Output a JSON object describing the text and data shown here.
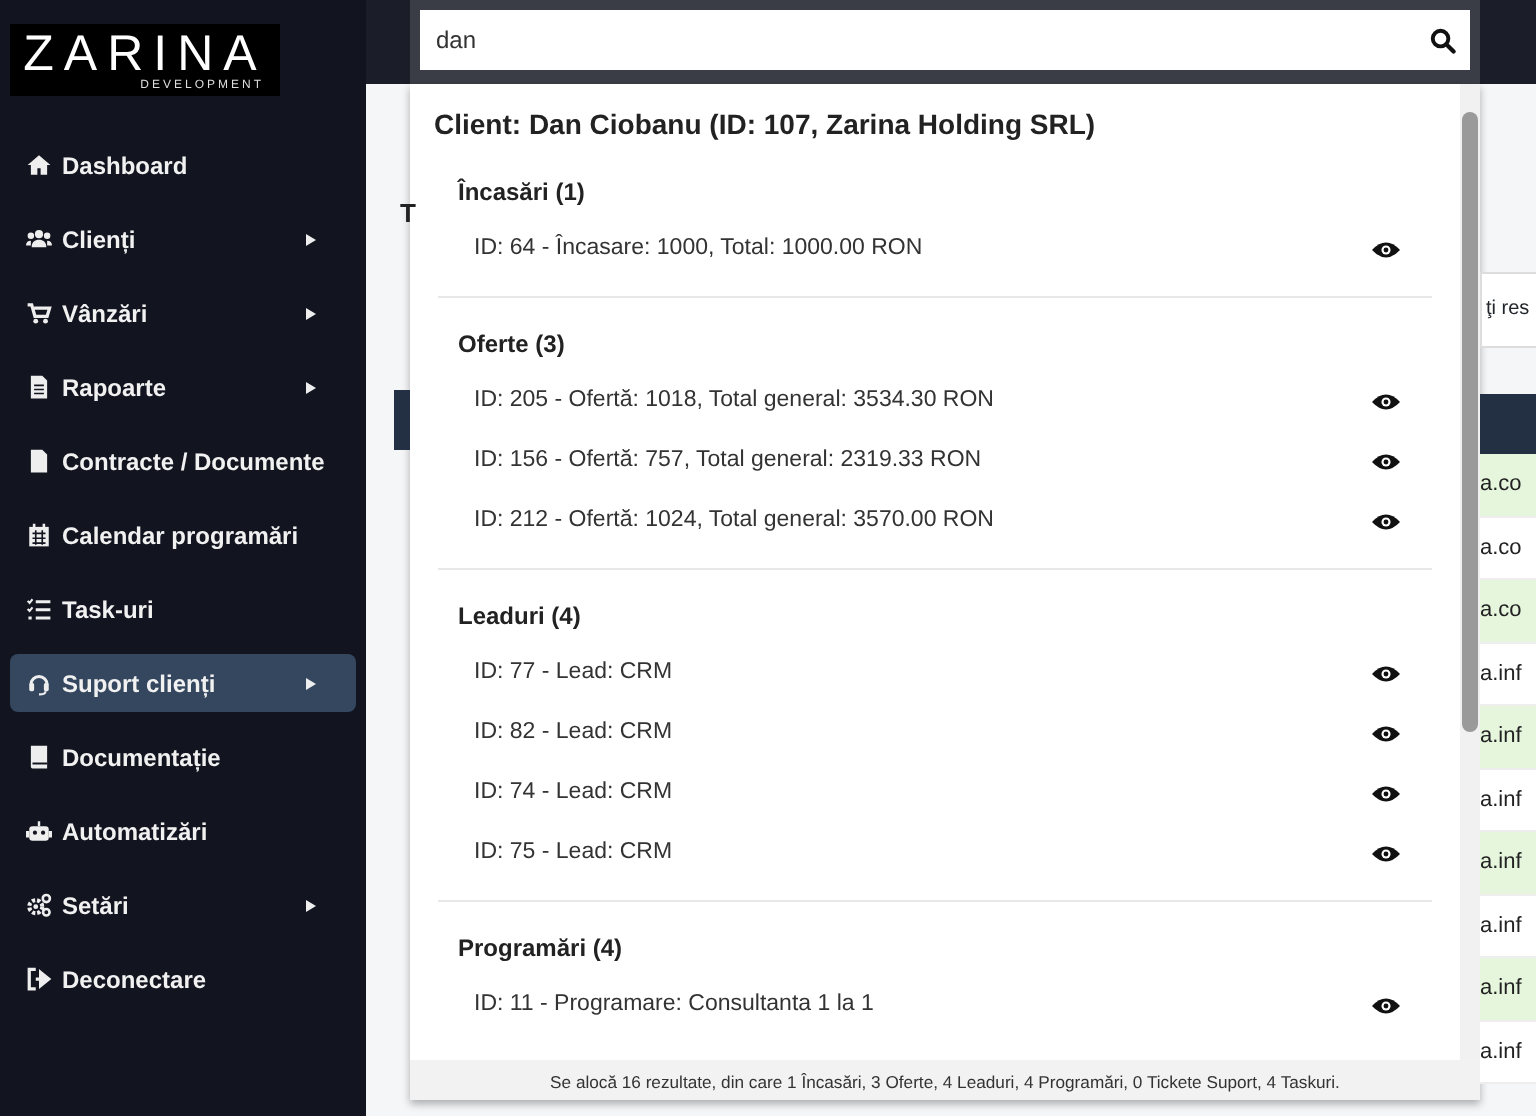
{
  "sidebar": {
    "logo": {
      "title": "ZARINA",
      "subtitle": "DEVELOPMENT"
    },
    "items": [
      {
        "label": "Dashboard",
        "has_submenu": false,
        "selected": false
      },
      {
        "label": "Clienți",
        "has_submenu": true,
        "selected": false
      },
      {
        "label": "Vânzări",
        "has_submenu": true,
        "selected": false
      },
      {
        "label": "Rapoarte",
        "has_submenu": true,
        "selected": false
      },
      {
        "label": "Contracte / Documente",
        "has_submenu": false,
        "selected": false
      },
      {
        "label": "Calendar programări",
        "has_submenu": false,
        "selected": false
      },
      {
        "label": "Task-uri",
        "has_submenu": false,
        "selected": false
      },
      {
        "label": "Suport clienți",
        "has_submenu": true,
        "selected": true
      },
      {
        "label": "Documentație",
        "has_submenu": false,
        "selected": false
      },
      {
        "label": "Automatizări",
        "has_submenu": false,
        "selected": false
      },
      {
        "label": "Setări",
        "has_submenu": true,
        "selected": false
      },
      {
        "label": "Deconectare",
        "has_submenu": false,
        "selected": false
      }
    ]
  },
  "search": {
    "value": "dan"
  },
  "results": {
    "client": "Client: Dan Ciobanu (ID: 107, Zarina Holding SRL)",
    "groups": [
      {
        "title": "Încasări (1)",
        "items": [
          "ID: 64 - Încasare: 1000, Total: 1000.00 RON"
        ]
      },
      {
        "title": "Oferte (3)",
        "items": [
          "ID: 205 - Ofertă: 1018, Total general: 3534.30 RON",
          "ID: 156 - Ofertă: 757, Total general: 2319.33 RON",
          "ID: 212 - Ofertă: 1024, Total general: 3570.00 RON"
        ]
      },
      {
        "title": "Leaduri (4)",
        "items": [
          "ID: 77 - Lead: CRM",
          "ID: 82 - Lead: CRM",
          "ID: 74 - Lead: CRM",
          "ID: 75 - Lead: CRM"
        ]
      },
      {
        "title": "Programări (4)",
        "items": [
          "ID: 11 - Programare: Consultanta 1 la 1"
        ]
      }
    ],
    "summary": "Se alocă 16 rezultate, din care 1 Încasări, 3 Oferte, 4 Leaduri, 4 Programări, 0 Tickete Suport, 4 Taskuri."
  },
  "background": {
    "heading": "T",
    "filter_text": "ţi res",
    "rows": [
      {
        "text": "a.co",
        "highlighted": true
      },
      {
        "text": "a.co",
        "highlighted": false
      },
      {
        "text": "a.co",
        "highlighted": true
      },
      {
        "text": "a.inf",
        "highlighted": false
      },
      {
        "text": "a.inf",
        "highlighted": true
      },
      {
        "text": "a.inf",
        "highlighted": false
      },
      {
        "text": "a.inf",
        "highlighted": true
      },
      {
        "text": "a.inf",
        "highlighted": false
      },
      {
        "text": "a.inf",
        "highlighted": true
      },
      {
        "text": "a.inf",
        "highlighted": false
      }
    ]
  }
}
